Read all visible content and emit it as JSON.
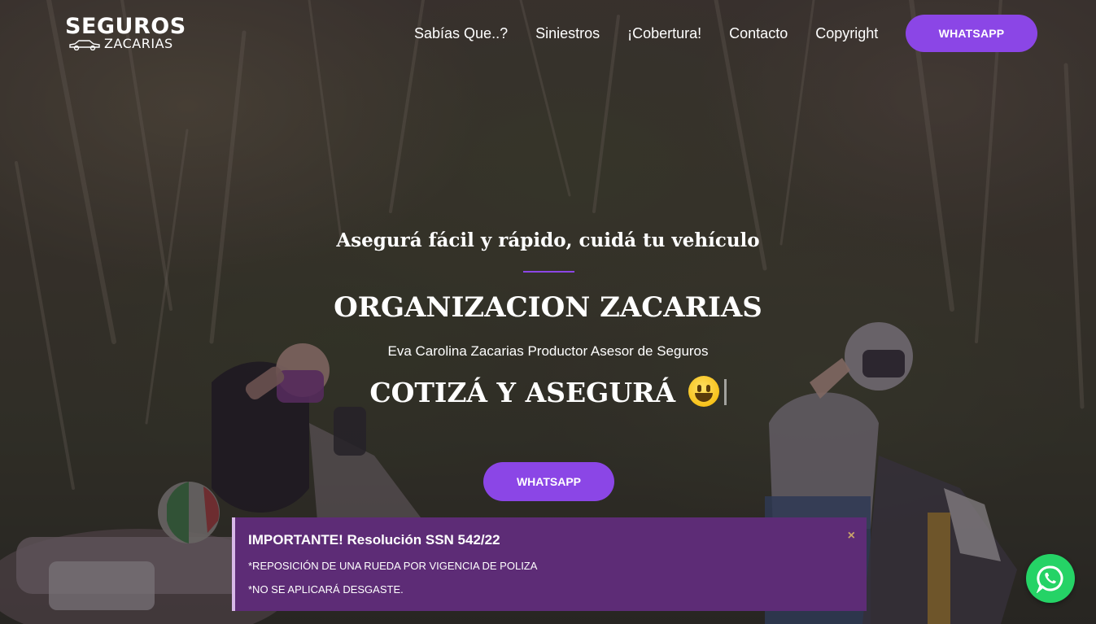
{
  "header": {
    "logo_top": "SEGUROS",
    "logo_bottom": "ZACARIAS",
    "nav": [
      {
        "label": "Sabías Que..?"
      },
      {
        "label": "Siniestros"
      },
      {
        "label": "¡Cobertura!"
      },
      {
        "label": "Contacto"
      },
      {
        "label": "Copyright"
      }
    ],
    "cta_label": "WHATSAPP"
  },
  "hero": {
    "tagline": "Asegurá fácil y rápido, cuidá tu vehículo",
    "title": "ORGANIZACION ZACARIAS",
    "subtitle": "Eva Carolina Zacarias Productor Asesor de Seguros",
    "typed_text": "COTIZÁ Y ASEGURÁ",
    "button_label": "WHATSAPP"
  },
  "notice": {
    "title": "IMPORTANTE! Resolución SSN 542/22",
    "line1": "*REPOSICIÓN DE UNA RUEDA POR VIGENCIA DE POLIZA",
    "line2": "*NO SE APLICARÁ DESGASTE.",
    "close_symbol": "×"
  },
  "icons": {
    "float_button": "whatsapp-icon",
    "emoji": "grinning-face-icon",
    "logo_car": "car-icon"
  },
  "colors": {
    "accent": "#8b46e6",
    "notice_bg": "#5d2c76",
    "whatsapp": "#25d366"
  }
}
